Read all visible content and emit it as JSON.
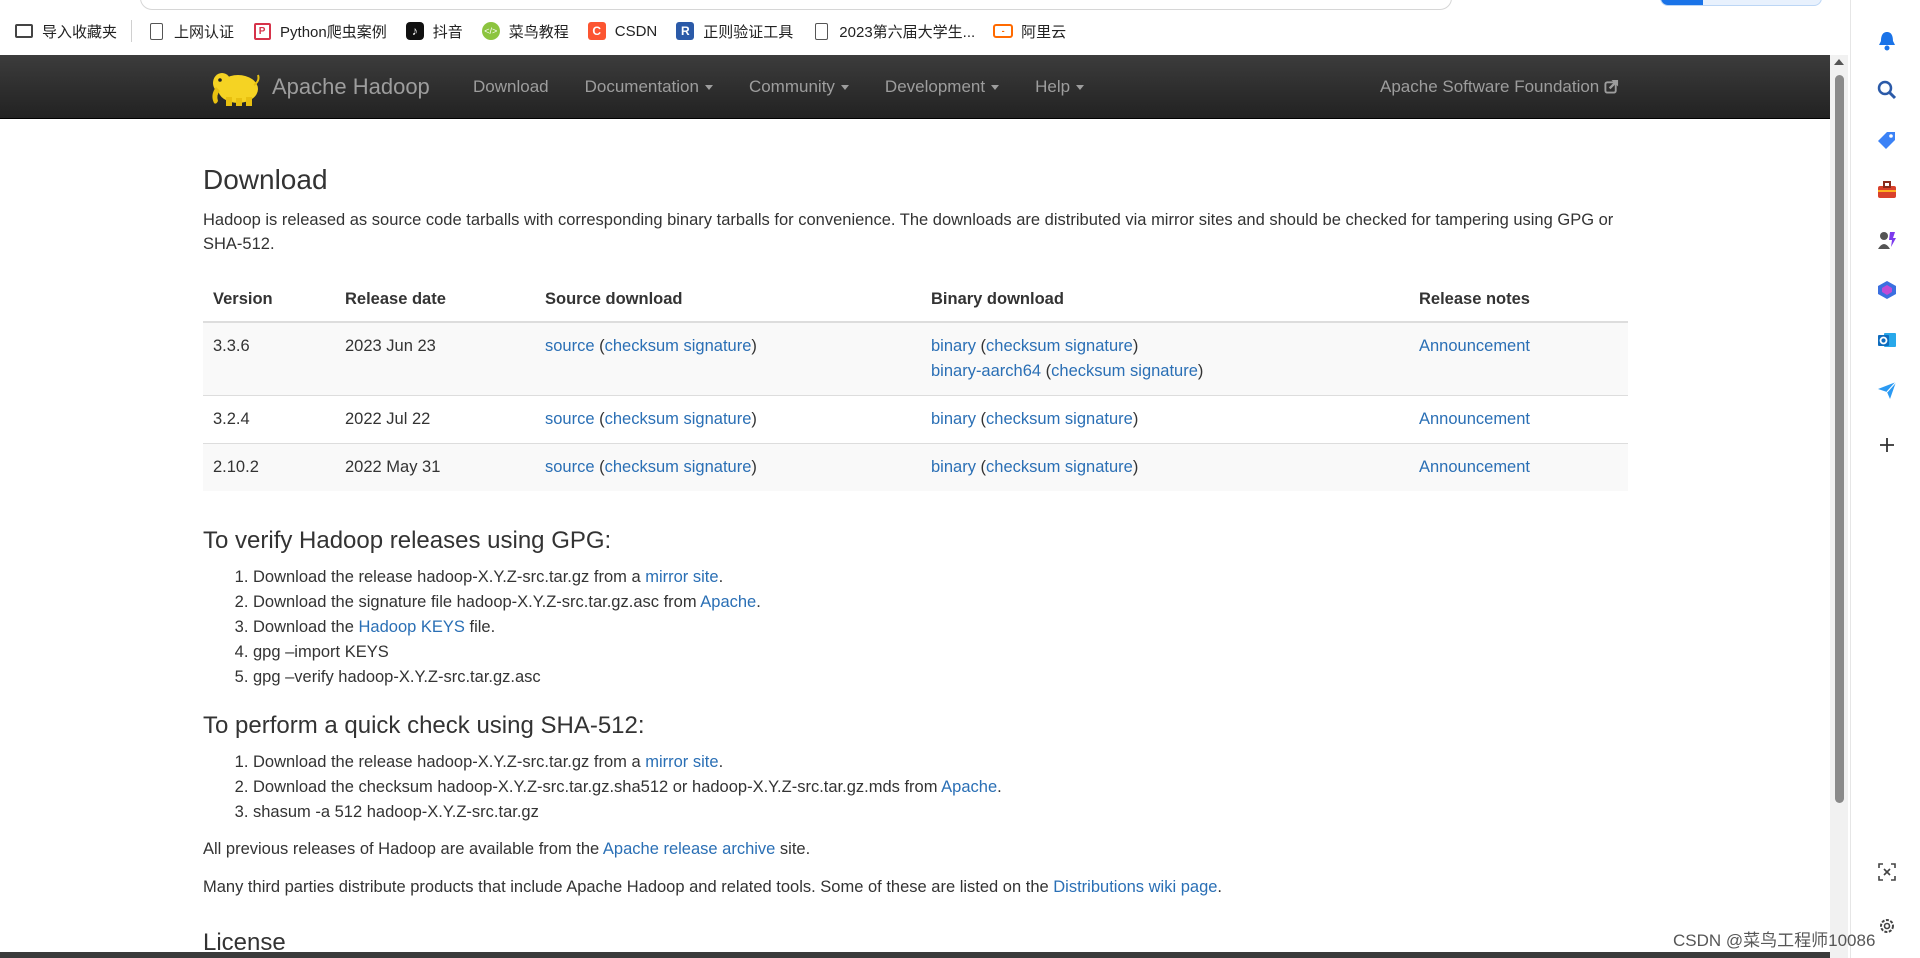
{
  "bookmarks": [
    {
      "label": "导入收藏夹",
      "icon": "folder-import-icon"
    },
    {
      "label": "上网认证",
      "icon": "page-icon"
    },
    {
      "label": "Python爬虫案例",
      "icon": "python-site-icon"
    },
    {
      "label": "抖音",
      "icon": "tiktok-icon"
    },
    {
      "label": "菜鸟教程",
      "icon": "runoob-icon"
    },
    {
      "label": "CSDN",
      "icon": "csdn-icon"
    },
    {
      "label": "正则验证工具",
      "icon": "regex-tool-icon"
    },
    {
      "label": "2023第六届大学生...",
      "icon": "page-icon"
    },
    {
      "label": "阿里云",
      "icon": "aliyun-icon"
    }
  ],
  "navbar": {
    "brand": "Apache Hadoop",
    "links": [
      {
        "label": "Download",
        "dropdown": false
      },
      {
        "label": "Documentation",
        "dropdown": true
      },
      {
        "label": "Community",
        "dropdown": true
      },
      {
        "label": "Development",
        "dropdown": true
      },
      {
        "label": "Help",
        "dropdown": true
      }
    ],
    "asf": "Apache Software Foundation"
  },
  "page": {
    "title": "Download",
    "intro": "Hadoop is released as source code tarballs with corresponding binary tarballs for convenience. The downloads are distributed via mirror sites and should be checked for tampering using GPG or SHA-512.",
    "table": {
      "headers": [
        "Version",
        "Release date",
        "Source download",
        "Binary download",
        "Release notes"
      ],
      "rows": [
        {
          "version": "3.3.6",
          "date": "2023 Jun 23",
          "source": "source",
          "checksum": "checksum",
          "signature": "signature",
          "binaries": [
            {
              "label": "binary",
              "checksum": "checksum",
              "signature": "signature"
            },
            {
              "label": "binary-aarch64",
              "checksum": "checksum",
              "signature": "signature"
            }
          ],
          "notes": "Announcement"
        },
        {
          "version": "3.2.4",
          "date": "2022 Jul 22",
          "source": "source",
          "checksum": "checksum",
          "signature": "signature",
          "binaries": [
            {
              "label": "binary",
              "checksum": "checksum",
              "signature": "signature"
            }
          ],
          "notes": "Announcement"
        },
        {
          "version": "2.10.2",
          "date": "2022 May 31",
          "source": "source",
          "checksum": "checksum",
          "signature": "signature",
          "binaries": [
            {
              "label": "binary",
              "checksum": "checksum",
              "signature": "signature"
            }
          ],
          "notes": "Announcement"
        }
      ]
    },
    "gpg": {
      "heading": "To verify Hadoop releases using GPG:",
      "steps": [
        {
          "pre": "Download the release hadoop-X.Y.Z-src.tar.gz from a ",
          "link": "mirror site",
          "post": "."
        },
        {
          "pre": "Download the signature file hadoop-X.Y.Z-src.tar.gz.asc from ",
          "link": "Apache",
          "post": "."
        },
        {
          "pre": "Download the ",
          "link": "Hadoop KEYS",
          "post": " file."
        },
        {
          "pre": "gpg –import KEYS",
          "link": "",
          "post": ""
        },
        {
          "pre": "gpg –verify hadoop-X.Y.Z-src.tar.gz.asc",
          "link": "",
          "post": ""
        }
      ]
    },
    "sha": {
      "heading": "To perform a quick check using SHA-512:",
      "steps": [
        {
          "pre": "Download the release hadoop-X.Y.Z-src.tar.gz from a ",
          "link": "mirror site",
          "post": "."
        },
        {
          "pre": "Download the checksum hadoop-X.Y.Z-src.tar.gz.sha512 or hadoop-X.Y.Z-src.tar.gz.mds from ",
          "link": "Apache",
          "post": "."
        },
        {
          "pre": "shasum -a 512 hadoop-X.Y.Z-src.tar.gz",
          "link": "",
          "post": ""
        }
      ]
    },
    "archive": {
      "pre": "All previous releases of Hadoop are available from the ",
      "link": "Apache release archive",
      "post": " site."
    },
    "thirdparty": {
      "pre": "Many third parties distribute products that include Apache Hadoop and related tools. Some of these are listed on the ",
      "link": "Distributions wiki page",
      "post": "."
    },
    "license_heading": "License"
  },
  "sidebar_icons": [
    "bell-icon",
    "search-icon",
    "tag-icon",
    "toolbox-icon",
    "games-icon",
    "office-icon",
    "outlook-icon",
    "send-icon",
    "add-icon",
    "screenshot-icon",
    "settings-icon"
  ],
  "watermark": "CSDN @菜鸟工程师10086",
  "colors": {
    "link": "#2a6fb5",
    "navbar": "#222222",
    "nav_text": "#9d9d9d"
  }
}
